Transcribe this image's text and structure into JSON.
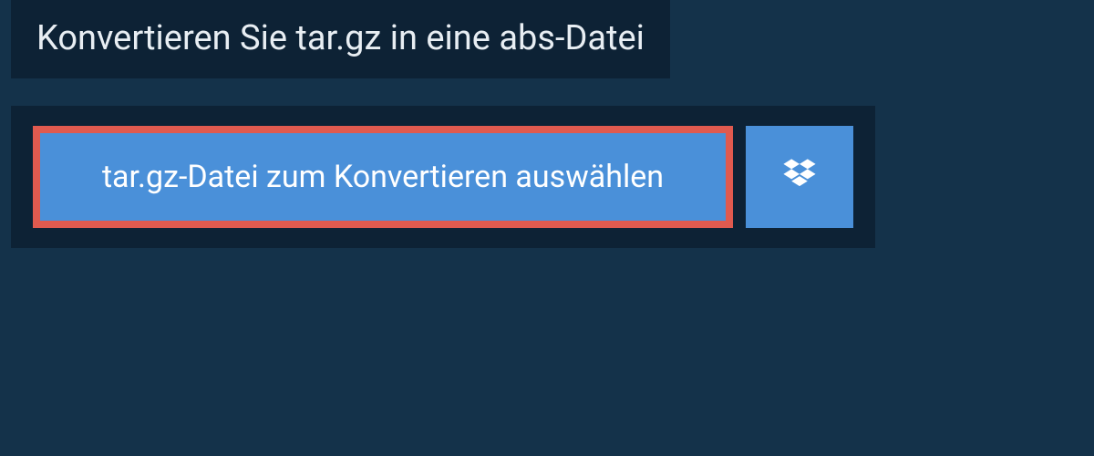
{
  "header": {
    "title": "Konvertieren Sie tar.gz in eine abs-Datei"
  },
  "upload": {
    "select_button_label": "tar.gz-Datei zum Konvertieren auswählen"
  }
}
